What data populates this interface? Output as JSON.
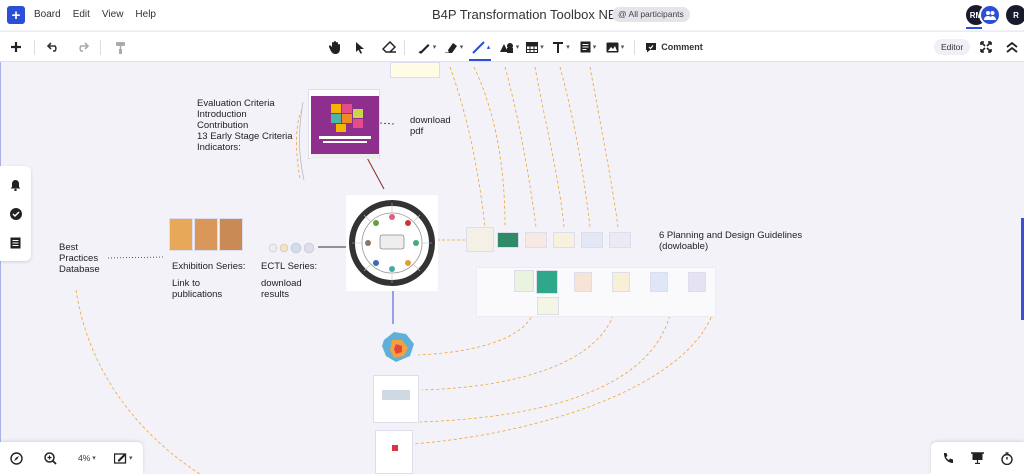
{
  "menubar": {
    "items": [
      "Board",
      "Edit",
      "View",
      "Help"
    ],
    "title": "B4P Transformation Toolbox NEW",
    "participants_label": "@ All participants",
    "avatars": [
      "RM",
      "R"
    ]
  },
  "toolbar": {
    "comment_label": "Comment",
    "editor_label": "Editor"
  },
  "canvas": {
    "evaluation": [
      "Evaluation Criteria",
      "Introduction",
      "Contribution",
      "13 Early Stage Criteria",
      "Indicators:"
    ],
    "download_pdf": [
      "download",
      "pdf"
    ],
    "best_practices": [
      "Best",
      "Practices",
      "Database"
    ],
    "exhibition": [
      "Exhibition Series:",
      "",
      "Link to",
      "publications"
    ],
    "ectl": [
      "ECTL Series:",
      "",
      "download",
      "results"
    ],
    "guidelines": [
      "6 Planning and Design Guidelines",
      "(dowloable)"
    ]
  },
  "zoom": {
    "level": "4%"
  },
  "colors": {
    "accent": "#2b4fd6",
    "connector": "#f0a530",
    "canvas_bg": "#f2f2f8"
  },
  "icons": {
    "logo": "plus-logo-icon",
    "toolbar": [
      "add-icon",
      "undo-icon",
      "redo-icon",
      "format-painter-icon",
      "hand-icon",
      "select-icon",
      "eraser-icon",
      "pen-icon",
      "highlighter-icon",
      "line-icon",
      "shapes-icon",
      "table-icon",
      "text-icon",
      "note-icon",
      "image-icon",
      "comment-icon",
      "fullscreen-icon",
      "collapse-icon"
    ],
    "side": [
      "bell-icon",
      "check-circle-icon",
      "list-icon"
    ],
    "bottom": [
      "compass-icon",
      "zoom-icon",
      "pen-tablet-icon",
      "phone-icon",
      "presentation-icon",
      "timer-icon"
    ]
  }
}
